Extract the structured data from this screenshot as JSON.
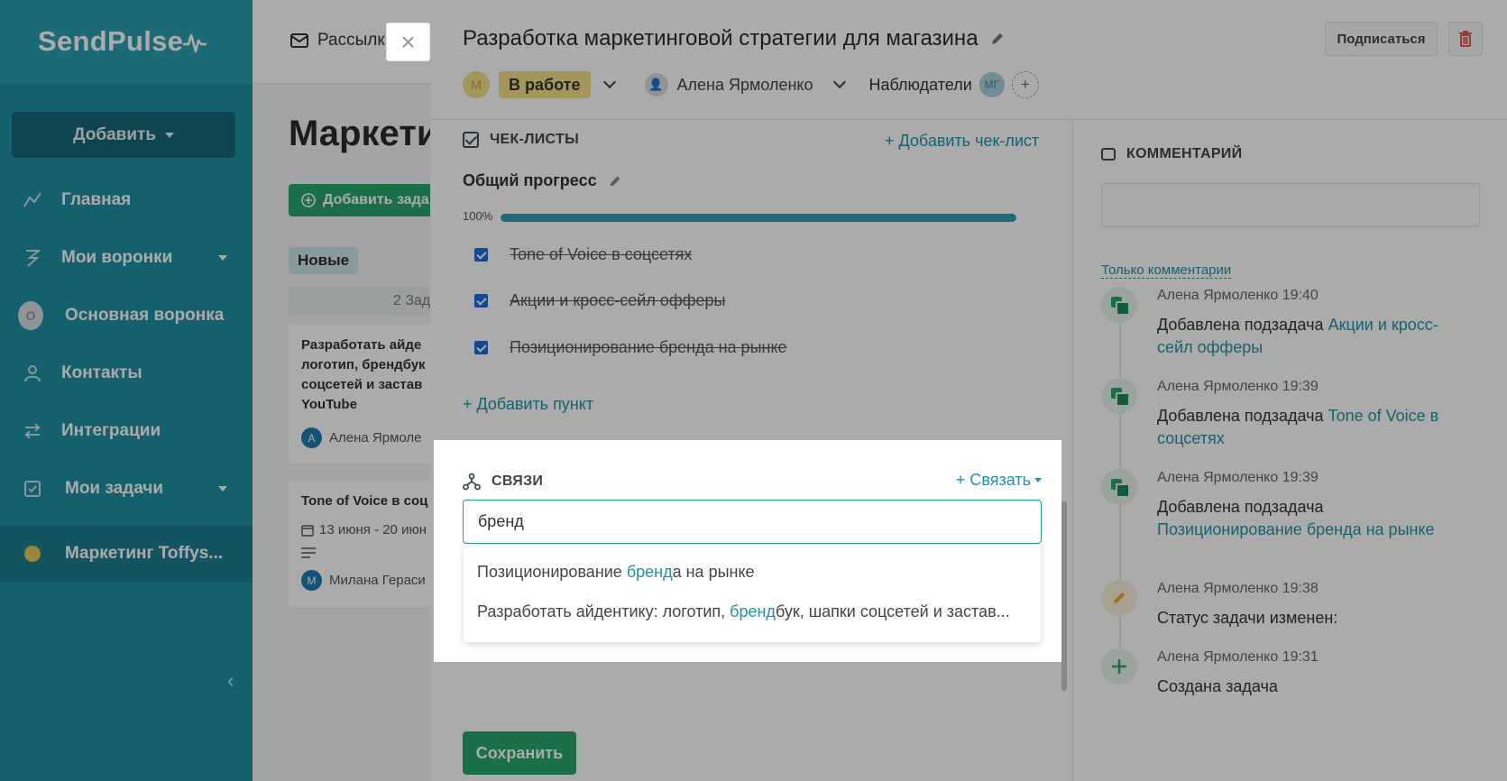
{
  "sidebar": {
    "logo": "SendPulse",
    "add_button": "Добавить",
    "items": [
      {
        "label": "Главная",
        "icon": "chart-line-icon"
      },
      {
        "label": "Мои воронки",
        "icon": "funnel-icon",
        "has_caret": true
      },
      {
        "label": "Основная воронка",
        "icon": "funnel-avatar-icon"
      },
      {
        "label": "Контакты",
        "icon": "contacts-icon"
      },
      {
        "label": "Интеграции",
        "icon": "integrations-icon"
      },
      {
        "label": "Мои задачи",
        "icon": "tasks-icon",
        "has_caret": true
      },
      {
        "label": "Маркетинг Toffys...",
        "icon": "project-dot-icon"
      }
    ]
  },
  "background": {
    "mail_tab": "Рассылк",
    "page_title": "Маркети",
    "add_task": "Добавить зада",
    "column_badge": "Новые",
    "task_count": "2 Зад",
    "card1": {
      "lines": [
        "Разработать айде",
        "логотип, брендбук",
        "соцсетей и застав",
        "YouTube"
      ],
      "avatar": "А",
      "assignee": "Алена Ярмоле"
    },
    "card2": {
      "title": "Tone of Voice в соц",
      "date": "13 июня - 20 июн",
      "avatar": "М",
      "assignee": "Милана Гераси"
    }
  },
  "task": {
    "title": "Разработка маркетинговой стратегии для магазина",
    "subscribe": "Подписаться",
    "status_avatar": "М",
    "status": "В работе",
    "assignee": "Алена Ярмоленко",
    "observers_label": "Наблюдатели",
    "observer_avatar": "МГ",
    "add_observer": "+"
  },
  "checklists": {
    "title": "ЧЕК-ЛИСТЫ",
    "add_checklist": "+ Добавить чек-лист",
    "progress_title": "Общий прогресс",
    "progress_label": "100%",
    "progress_value": 1.0,
    "items": [
      {
        "label": "Tone of Voice в соцсетях",
        "done": true
      },
      {
        "label": "Акции и кросс-сейл офферы",
        "done": true
      },
      {
        "label": "Позиционирование бренда на рынке",
        "done": true
      }
    ],
    "add_item": "+ Добавить пункт"
  },
  "links": {
    "title": "СВЯЗИ",
    "link_button": "+ Связать",
    "search_value": "бренд",
    "results": [
      {
        "before": "Позиционирование ",
        "match": "бренд",
        "after": "а на рынке"
      },
      {
        "before": "Разработать айдентику: логотип, ",
        "match": "бренд",
        "after": "бук, шапки соцсетей и застав..."
      }
    ]
  },
  "save_button": "Сохранить",
  "comments": {
    "title": "КОММЕНТАРИЙ",
    "only_comments": "Только комментарии",
    "activities": [
      {
        "author": "Алена Ярмоленко",
        "time": "19:40",
        "text": "Добавлена подзадача ",
        "link": "Акции и кросс-сейл офферы",
        "icon": "subtask-icon"
      },
      {
        "author": "Алена Ярмоленко",
        "time": "19:39",
        "text": "Добавлена подзадача ",
        "link": "Tone of Voice в соцсетях",
        "icon": "subtask-icon"
      },
      {
        "author": "Алена Ярмоленко",
        "time": "19:39",
        "text": "Добавлена подзадача ",
        "link": "Позиционирование бренда на рынке",
        "icon": "subtask-icon"
      },
      {
        "author": "Алена Ярмоленко",
        "time": "19:38",
        "text": "Статус задачи изменен:",
        "link": "",
        "icon": "pencil-icon"
      },
      {
        "author": "Алена Ярмоленко",
        "time": "19:31",
        "text": "Создана задача",
        "link": "",
        "icon": "plus-icon"
      }
    ]
  },
  "colors": {
    "sidebar": "#1f8fa1",
    "accent_teal": "#1f92a8",
    "green": "#28a66a",
    "status_yellow": "#f3e08a",
    "delete_red": "#e04b3a"
  }
}
